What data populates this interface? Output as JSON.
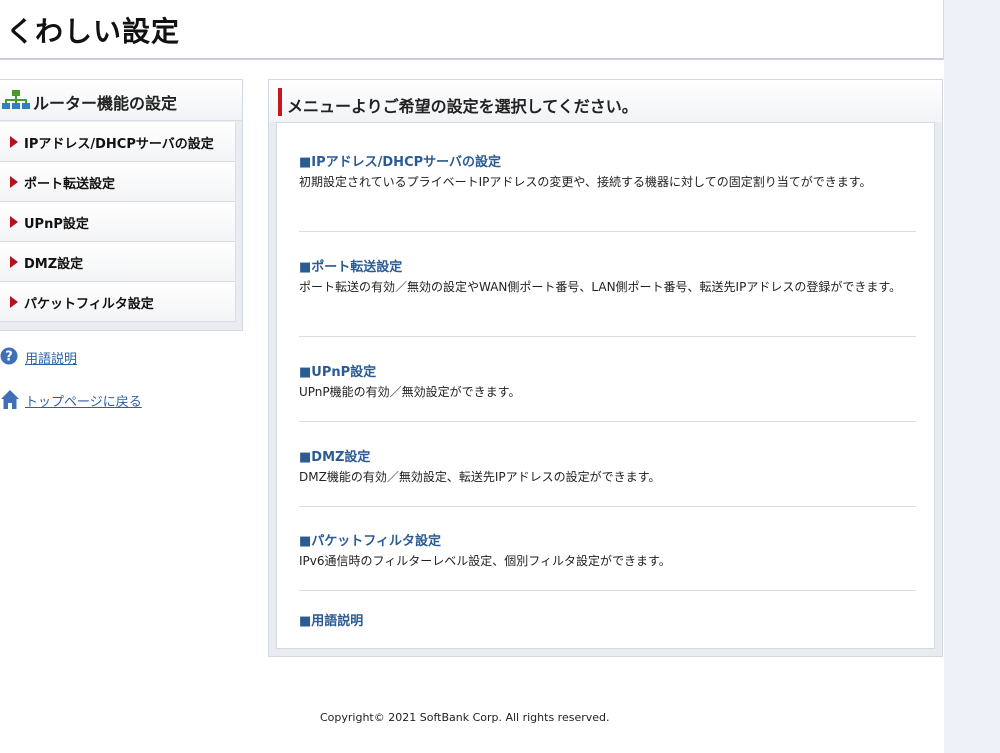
{
  "page": {
    "title": "くわしい設定"
  },
  "sidebar": {
    "title": "ルーター機能の設定",
    "items": [
      {
        "label": "IPアドレス/DHCPサーバの設定"
      },
      {
        "label": "ポート転送設定"
      },
      {
        "label": "UPnP設定"
      },
      {
        "label": "DMZ設定"
      },
      {
        "label": "パケットフィルタ設定"
      }
    ],
    "links": [
      {
        "label": "用語説明",
        "icon": "help-icon"
      },
      {
        "label": "トップページに戻る",
        "icon": "home-icon"
      }
    ]
  },
  "main": {
    "title": "メニューよりご希望の設定を選択してください。",
    "sections": [
      {
        "title": "■IPアドレス/DHCPサーバの設定",
        "desc": "初期設定されているプライベートIPアドレスの変更や、接続する機器に対しての固定割り当てができます。"
      },
      {
        "title": "■ポート転送設定",
        "desc": "ポート転送の有効／無効の設定やWAN側ポート番号、LAN側ポート番号、転送先IPアドレスの登録ができます。"
      },
      {
        "title": "■UPnP設定",
        "desc": "UPnP機能の有効／無効設定ができます。"
      },
      {
        "title": "■DMZ設定",
        "desc": "DMZ機能の有効／無効設定、転送先IPアドレスの設定ができます。"
      },
      {
        "title": "■パケットフィルタ設定",
        "desc": "IPv6通信時のフィルターレベル設定、個別フィルタ設定ができます。"
      },
      {
        "title": "■用語説明",
        "desc": ""
      }
    ]
  },
  "footer": {
    "copyright": "Copyright© 2021 SoftBank Corp. All rights reserved."
  },
  "colors": {
    "accent": "#c8161e",
    "link": "#2b5fa8",
    "section_title": "#2b5b93"
  }
}
